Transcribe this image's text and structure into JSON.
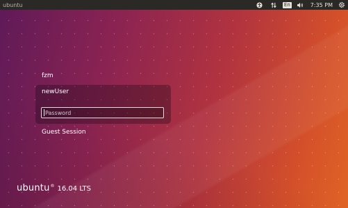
{
  "panel": {
    "hostname": "ubuntu",
    "keyboard_layout": "En",
    "clock": "7:35 PM",
    "icons": {
      "accessibility": "accessibility-icon",
      "network": "network-arrows-icon",
      "volume": "volume-icon",
      "power": "gear-power-icon"
    }
  },
  "login": {
    "users": [
      {
        "name": "fzm"
      },
      {
        "name": "newUser"
      }
    ],
    "password_placeholder": "Password",
    "guest_label": "Guest Session"
  },
  "brand": {
    "name": "ubuntu",
    "mark": "®",
    "version": "16.04 LTS"
  },
  "colors": {
    "panel_bg": "#2b2926",
    "accent_white": "#ffffff"
  }
}
